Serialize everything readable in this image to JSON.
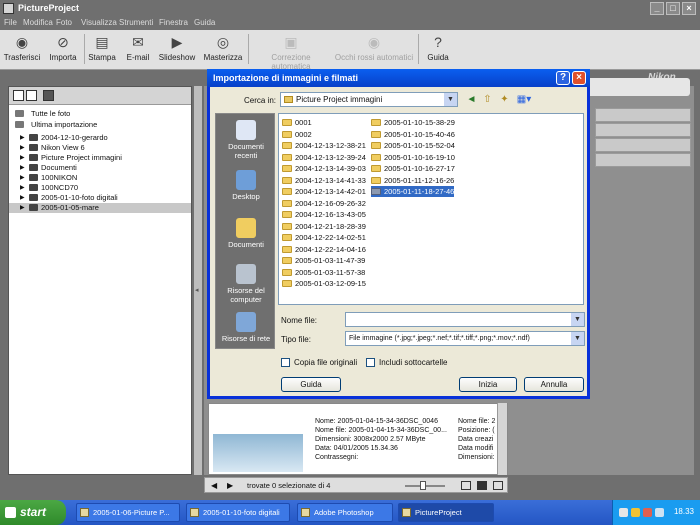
{
  "app": {
    "title": "PictureProject",
    "brand": "Nikon"
  },
  "menu": [
    "File",
    "Modifica",
    "Foto",
    "Visualizza",
    "Strumenti",
    "Finestra",
    "Guida"
  ],
  "toolbar": {
    "trasferisci": "Trasferisci",
    "importa": "Importa",
    "stampa": "Stampa",
    "email": "E-mail",
    "slideshow": "Slideshow",
    "masterizza": "Masterizza",
    "correzione": "Correzione automatica",
    "occhi": "Occhi rossi automatici",
    "guida": "Guida"
  },
  "tree": {
    "all": "Tutte le foto",
    "last": "Ultima importazione",
    "items": [
      "2004-12-10-gerardo",
      "Nikon View 6",
      "Picture Project immagini",
      "Documenti",
      "100NIKON",
      "100NCD70",
      "2005-01-10-foto digitali",
      "2005-01-05-mare"
    ],
    "selected_index": 7
  },
  "dialog": {
    "title": "Importazione di immagini e filmati",
    "look_in_label": "Cerca in:",
    "look_in_value": "Picture Project immagini",
    "places": [
      "Documenti recenti",
      "Desktop",
      "Documenti",
      "Risorse del computer",
      "Risorse di rete"
    ],
    "folders_col1": [
      "0001",
      "0002",
      "2004-12-13-12-38-21",
      "2004-12-13-12-39-24",
      "2004-12-13-14-39-03",
      "2004-12-13-14-41-33",
      "2004-12-13-14-42-01",
      "2004-12-16-09-26-32",
      "2004-12-16-13-43-05",
      "2004-12-21-18-28-39",
      "2004-12-22-14-02-51",
      "2004-12-22-14-04-16",
      "2005-01-03-11-47-39",
      "2005-01-03-11-57-38",
      "2005-01-03-12-09-15"
    ],
    "folders_col2": [
      "2005-01-10-15-38-29",
      "2005-01-10-15-40-46",
      "2005-01-10-15-52-04",
      "2005-01-10-16-19-10",
      "2005-01-10-16-27-17",
      "2005-01-11-12-16-26",
      "2005-01-11-18-27-46"
    ],
    "selected_folder": "2005-01-11-18-27-46",
    "filename_label": "Nome file:",
    "filename_value": "",
    "filetype_label": "Tipo file:",
    "filetype_value": "File immagine (*.jpg;*.jpeg;*.nef;*.tif;*.tiff;*.png;*.mov;*.ndf)",
    "copy_originals": "Copia file originali",
    "include_subfolders": "Includi sottocartelle",
    "help_button": "Guida",
    "start_button": "Inizia",
    "cancel_button": "Annulla"
  },
  "info": {
    "lines": [
      "Nome: 2005-01-04-15-34-36DSC_0046",
      "Nome file: 2005-01-04-15-34-36DSC_00...",
      "Dimensioni: 3008x2000  2.57 MByte",
      "Data: 04/01/2005 15.34.36",
      "Contrassegni:"
    ],
    "lines_right": [
      "Nome file: 2",
      "Posizione: (",
      "Data creazi",
      "Data modifi",
      "Dimensioni:"
    ]
  },
  "status": "trovate 0 selezionate di 4",
  "taskbar": {
    "start": "start",
    "tasks": [
      "2005-01-06-Picture P...",
      "2005-01-10-foto digitali",
      "Adobe Photoshop",
      "PictureProject"
    ],
    "active_index": 3,
    "clock": "18.33"
  },
  "colors": {
    "xp_title": "#0a5ff0",
    "selection": "#316ac5",
    "taskbar": "#2456c4",
    "start": "#3a9a35"
  }
}
